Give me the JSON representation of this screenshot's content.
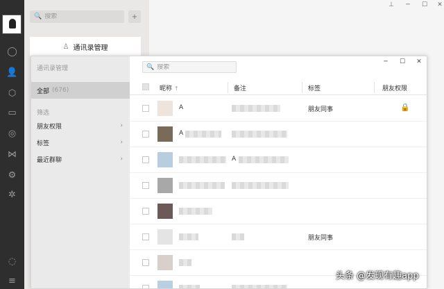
{
  "sidebar": {
    "search_placeholder": "搜索",
    "manager_button": "通讯录管理"
  },
  "manager": {
    "title": "通讯录管理",
    "all_label": "全部",
    "all_count": "(676)",
    "filter_label": "筛选",
    "filters": [
      "朋友权限",
      "标签",
      "最近群聊"
    ],
    "search_placeholder": "搜索",
    "columns": {
      "nickname": "昵称",
      "sort_arrow": "↑",
      "remark": "备注",
      "tag": "标签",
      "permission": "朋友权限"
    },
    "rows": [
      {
        "nick": "A",
        "remark": "",
        "tag": "朋友同事"
      },
      {
        "nick": "A",
        "remark": "",
        "tag": ""
      },
      {
        "nick": "",
        "remark": "A",
        "tag": ""
      },
      {
        "nick": "",
        "remark": "",
        "tag": ""
      },
      {
        "nick": "",
        "remark": "",
        "tag": ""
      },
      {
        "nick": "",
        "remark": "",
        "tag": "朋友同事"
      },
      {
        "nick": "",
        "remark": "",
        "tag": ""
      },
      {
        "nick": "",
        "remark": "",
        "tag": ""
      }
    ]
  },
  "watermark": "头条 @发现有趣app",
  "colors": {
    "accent_green": "#07c160",
    "rail": "#2e2e2e"
  }
}
